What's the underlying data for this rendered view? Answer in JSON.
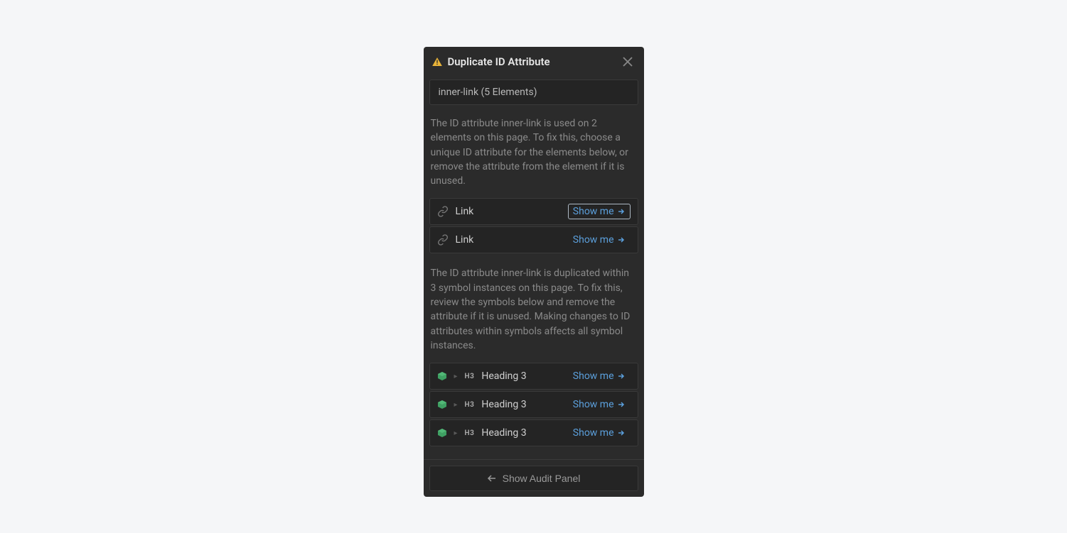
{
  "header": {
    "title": "Duplicate ID Attribute"
  },
  "idRow": {
    "text": "inner-link (5 Elements)"
  },
  "section1": {
    "description": "The ID attribute inner-link is used on 2 elements on this page. To fix this, choose a unique ID attribute for the elements below, or remove the attribute from the element if it is unused.",
    "items": [
      {
        "label": "Link",
        "action": "Show me"
      },
      {
        "label": "Link",
        "action": "Show me"
      }
    ]
  },
  "section2": {
    "description": "The ID attribute inner-link is duplicated within 3 symbol instances on this page. To fix this, review the symbols below and remove the attribute if it is unused. Making changes to ID attributes within symbols affects all symbol instances.",
    "items": [
      {
        "badge": "H3",
        "label": "Heading 3",
        "action": "Show me"
      },
      {
        "badge": "H3",
        "label": "Heading 3",
        "action": "Show me"
      },
      {
        "badge": "H3",
        "label": "Heading 3",
        "action": "Show me"
      }
    ]
  },
  "footer": {
    "label": "Show Audit Panel"
  }
}
